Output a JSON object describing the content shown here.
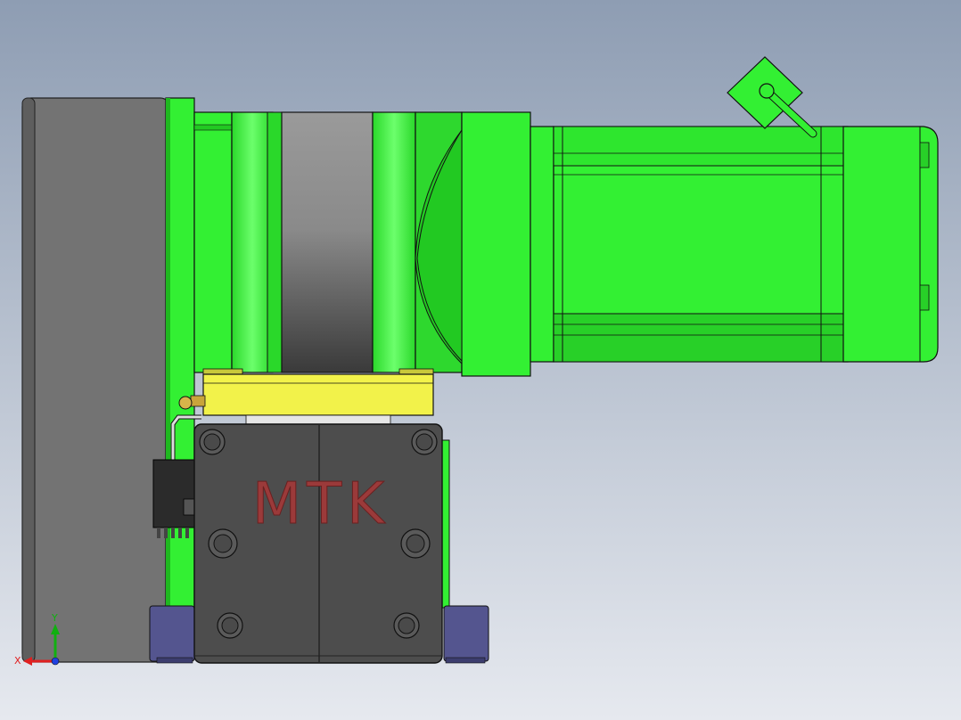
{
  "viewport": {
    "background_top": "#8e9db3",
    "background_bottom": "#e6e9ef"
  },
  "model": {
    "logo_text": "MTK",
    "logo_color": "#9b3a3a",
    "colors": {
      "green": "#33f033",
      "green_dark": "#1fb81f",
      "green_shadow": "#17a017",
      "gray_plate": "#777777",
      "gray_plate_edge": "#5a5a5a",
      "gearbox_gray": "#8a8a8a",
      "block_dark": "#4d4d4d",
      "yellow": "#f2f24a",
      "purple": "#54558f",
      "black_connector": "#2b2b2b"
    }
  },
  "triad": {
    "x_label": "X",
    "y_label": "Y",
    "x_color": "#e02020",
    "y_color": "#10b010",
    "z_color": "#2040e0"
  }
}
